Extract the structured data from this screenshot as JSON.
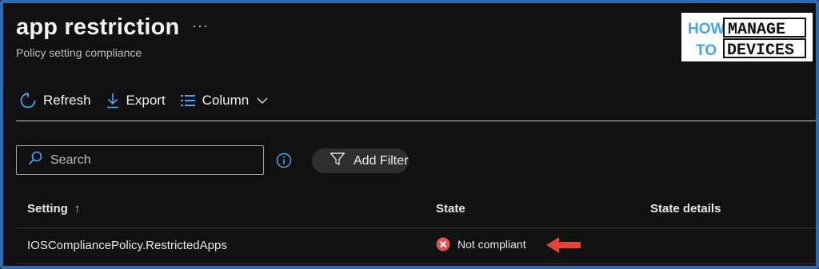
{
  "header": {
    "title": "app restriction",
    "more_label": "···",
    "subtitle": "Policy setting compliance"
  },
  "logo": {
    "line1_left": "HOW",
    "line1_right": "MANAGE",
    "line2_left": "TO",
    "line2_right": "DEVICES"
  },
  "toolbar": {
    "refresh_label": "Refresh",
    "export_label": "Export",
    "column_label": "Column"
  },
  "search": {
    "placeholder": "Search"
  },
  "filter": {
    "label": "Add Filter"
  },
  "table": {
    "columns": [
      "Setting",
      "State",
      "State details"
    ],
    "sort_indicator": "↑",
    "rows": [
      {
        "setting": "IOSCompliancePolicy.RestrictedApps",
        "state": "Not compliant",
        "state_details": ""
      }
    ]
  },
  "colors": {
    "accent": "#2b6cb8",
    "icon_blue": "#4aa3f0",
    "error_red": "#e05252",
    "arrow_red": "#e5423a"
  },
  "icons": [
    "ellipsis-icon",
    "refresh-icon",
    "download-icon",
    "list-icon",
    "chevron-down-icon",
    "search-icon",
    "info-icon",
    "filter-icon",
    "sort-up-icon",
    "error-icon",
    "arrow-left-icon"
  ]
}
